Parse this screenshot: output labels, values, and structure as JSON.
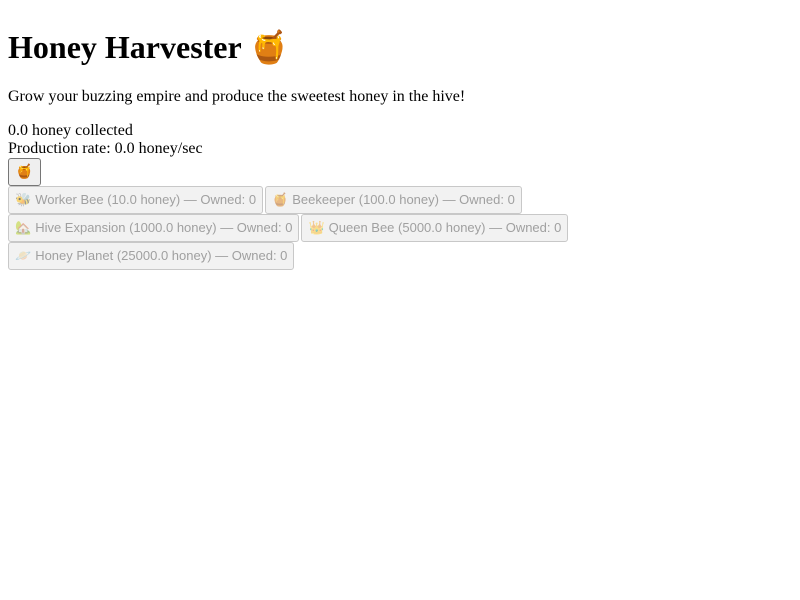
{
  "header": {
    "title": "Honey Harvester",
    "title_emoji": "🍯"
  },
  "tagline": "Grow your buzzing empire and produce the sweetest honey in the hive!",
  "stats": {
    "honey_collected": "0.0 honey collected",
    "production_rate": "Production rate: 0.0 honey/sec"
  },
  "click_button": {
    "label": "🍯"
  },
  "shop": {
    "items": [
      {
        "emoji": "🐝",
        "label": "Worker Bee (10.0 honey) — Owned: 0"
      },
      {
        "emoji": "🍯",
        "label": "Beekeeper (100.0 honey) — Owned: 0"
      },
      {
        "emoji": "🏡",
        "label": "Hive Expansion (1000.0 honey) — Owned: 0"
      },
      {
        "emoji": "👑",
        "label": "Queen Bee (5000.0 honey) — Owned: 0"
      },
      {
        "emoji": "🪐",
        "label": "Honey Planet (25000.0 honey) — Owned: 0"
      }
    ]
  }
}
